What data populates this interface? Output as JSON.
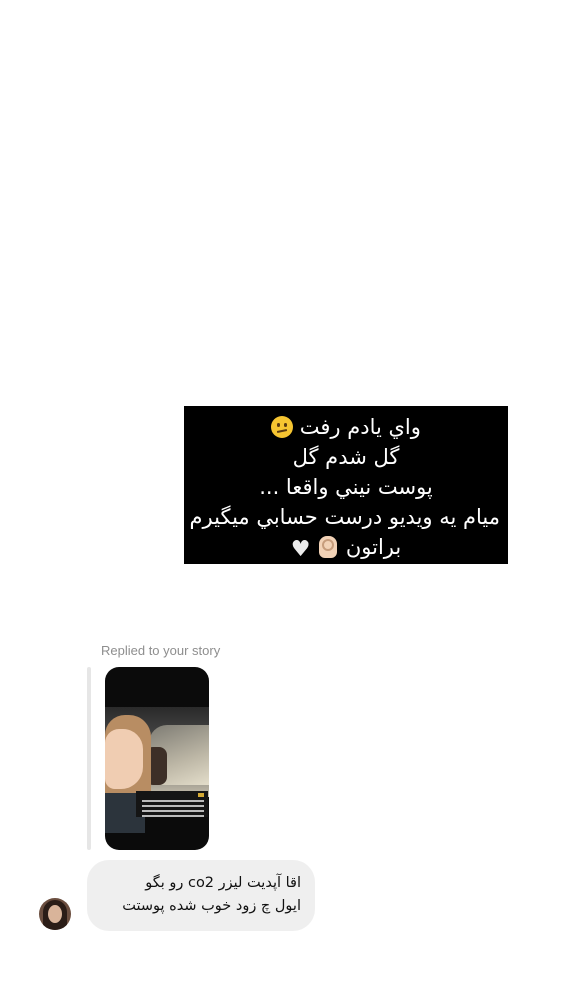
{
  "story_caption": {
    "lines": [
      "واي يادم رفت",
      "گل شدم گل",
      "پوست نيني واقعا ...",
      "ميام يه ويديو درست حسابي ميگيرم",
      "براتون"
    ],
    "emojis": [
      "confused-face",
      "ok-hand",
      "white-heart"
    ]
  },
  "reply": {
    "label": "Replied to your story"
  },
  "message": {
    "lines": [
      "اقا آپدیت لیزر co2 رو بگو",
      "ایول چ زود خوب شده پوستت"
    ]
  },
  "colors": {
    "background": "#ffffff",
    "caption_bg": "#000000",
    "bubble_bg": "#efefef",
    "label_gray": "#8e8e8e"
  }
}
